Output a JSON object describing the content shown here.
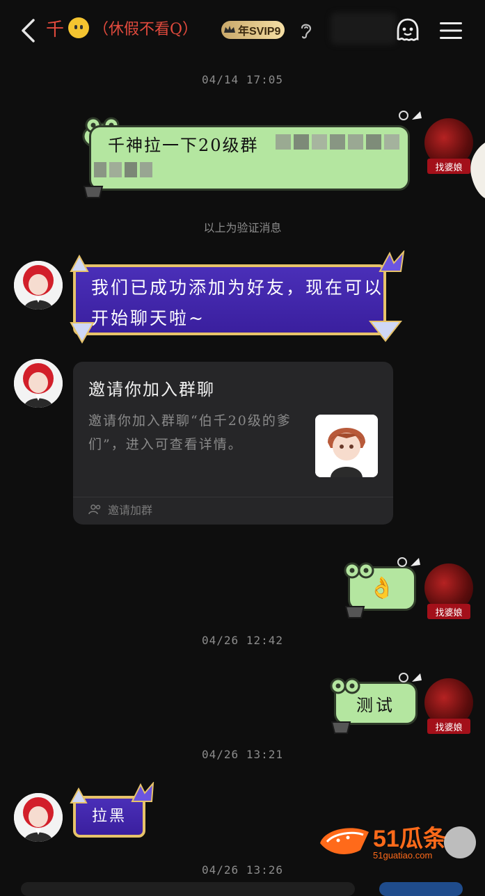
{
  "header": {
    "title": "千",
    "status": "（休假不看Q）",
    "vip": "年SVIP9"
  },
  "messages": {
    "ts1": "04/14 17:05",
    "verify_text": "千神拉一下20级群",
    "system_note": "以上为验证消息",
    "welcome": "我们已成功添加为好友，现在可以开始聊天啦~",
    "invite_title": "邀请你加入群聊",
    "invite_desc": "邀请你加入群聊“伯千20级的爹们”，进入可查看详情。",
    "invite_footer": "邀请加群",
    "ok_emoji": "👌",
    "ts2": "04/26 12:42",
    "test_text": "测试",
    "ts3": "04/26 13:21",
    "block_text": "拉黑",
    "ts4": "04/26 13:26"
  },
  "badges": {
    "right": "找婆娘"
  },
  "watermark": {
    "brand": "51瓜条",
    "domain": "51guatiao.com"
  },
  "colors": {
    "bg": "#0e0e0e",
    "frog_green": "#b4e6a0",
    "purple": "#4a2fb8",
    "gold": "#e7c36a",
    "badge_red": "#a3101a",
    "brand_orange": "#ff6a1a"
  }
}
